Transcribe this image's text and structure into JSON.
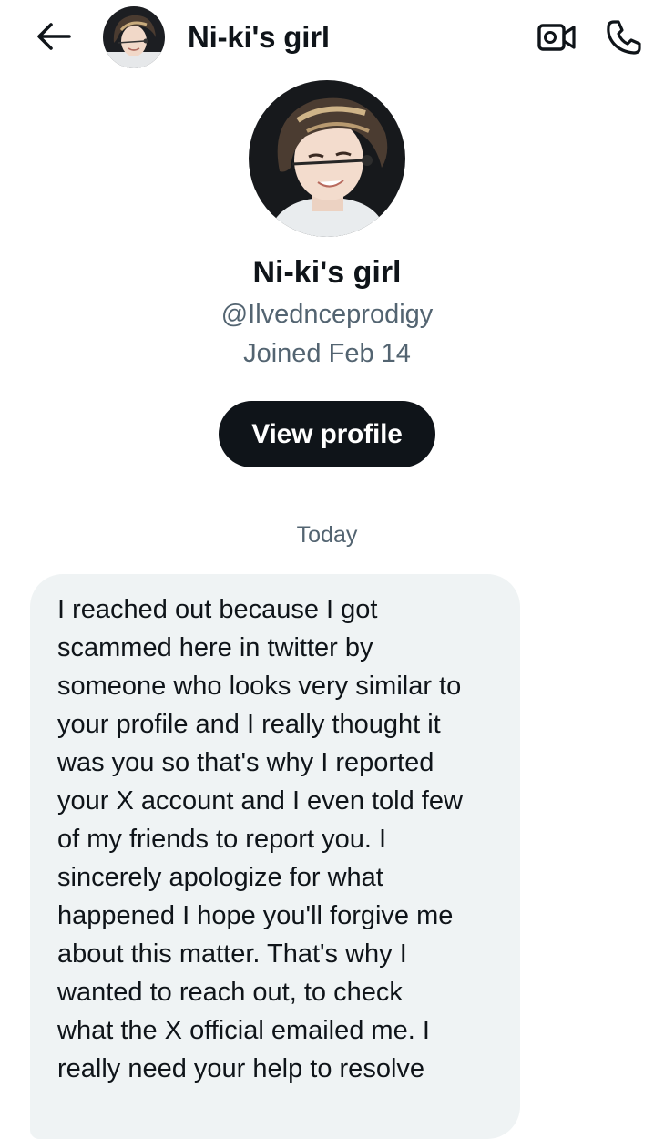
{
  "header": {
    "title": "Ni-ki's girl",
    "back_icon": "arrow-left-icon",
    "video_icon": "video-camera-icon",
    "phone_icon": "phone-icon"
  },
  "profile": {
    "name": "Ni-ki's girl",
    "handle": "@Ilvednceprodigy",
    "joined": "Joined Feb 14",
    "view_profile_label": "View profile"
  },
  "conversation": {
    "date_label": "Today",
    "messages": [
      {
        "direction": "incoming",
        "text": "I reached out because I got\nscammed here in twitter by\nsomeone who looks very similar to\nyour profile and I really thought it\nwas you so that's why I reported\nyour X account and I even told few\nof my friends to report you. I\nsincerely apologize for what\nhappened I hope you'll forgive me\nabout this matter. That's why I\nwanted to reach out, to check\nwhat the X official emailed me. I\nreally need your help to resolve"
      }
    ]
  },
  "colors": {
    "text_primary": "#0f1419",
    "text_secondary": "#536471",
    "bubble_bg": "#eff3f4",
    "button_bg": "#0f1419",
    "button_text": "#ffffff"
  }
}
